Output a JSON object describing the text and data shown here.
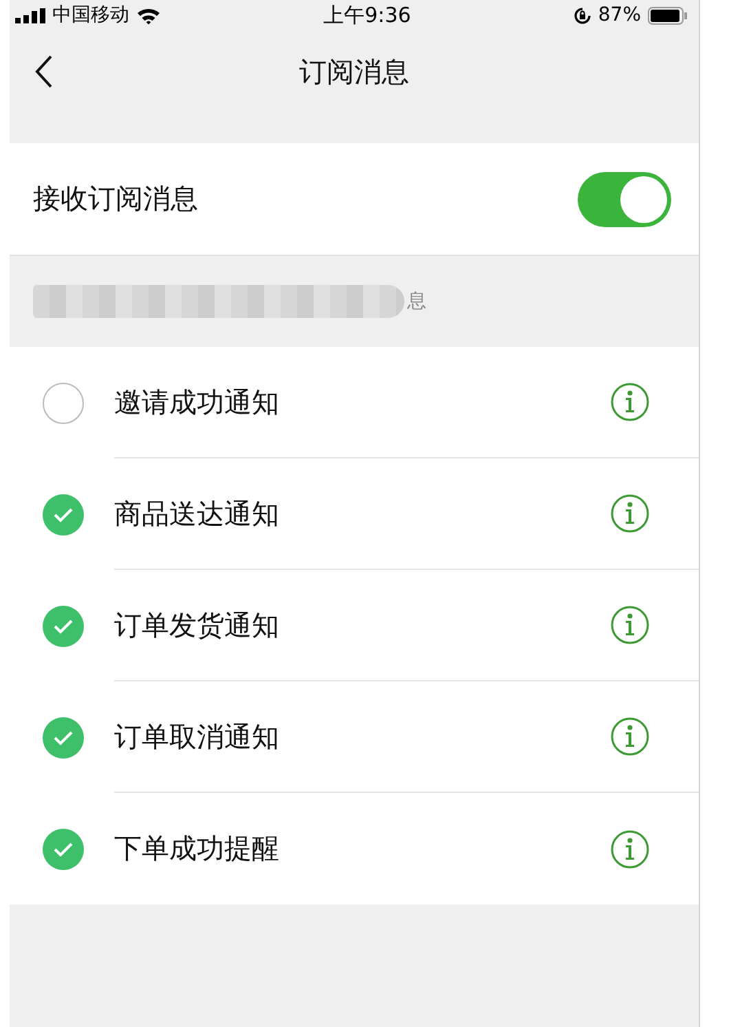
{
  "status_bar": {
    "carrier": "中国移动",
    "time": "上午9:36",
    "battery": "87%"
  },
  "nav": {
    "title": "订阅消息"
  },
  "master": {
    "label": "接收订阅消息",
    "on": true
  },
  "section_header": {
    "visible_text": "息"
  },
  "items": [
    {
      "label": "邀请成功通知",
      "checked": false
    },
    {
      "label": "商品送达通知",
      "checked": true
    },
    {
      "label": "订单发货通知",
      "checked": true
    },
    {
      "label": "订单取消通知",
      "checked": true
    },
    {
      "label": "下单成功提醒",
      "checked": true
    }
  ]
}
